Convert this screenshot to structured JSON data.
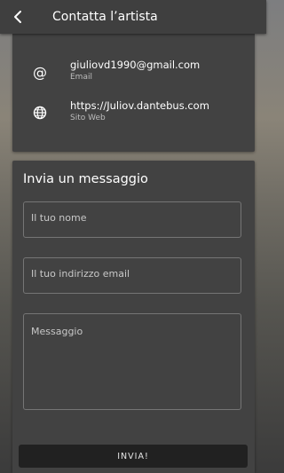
{
  "appbar": {
    "title": "Contatta l’artista",
    "back_icon": "arrow-back-icon"
  },
  "contacts": [
    {
      "icon": "at-sign-icon",
      "value": "giuliovd1990@gmail.com",
      "label": "Email"
    },
    {
      "icon": "globe-icon",
      "value": "https://Juliov.dantebus.com",
      "label": "Sito Web"
    }
  ],
  "form": {
    "title": "Invia un messaggio",
    "name_placeholder": "Il tuo nome",
    "email_placeholder": "Il tuo indirizzo email",
    "message_placeholder": "Messaggio",
    "submit_label": "INVIA!"
  }
}
